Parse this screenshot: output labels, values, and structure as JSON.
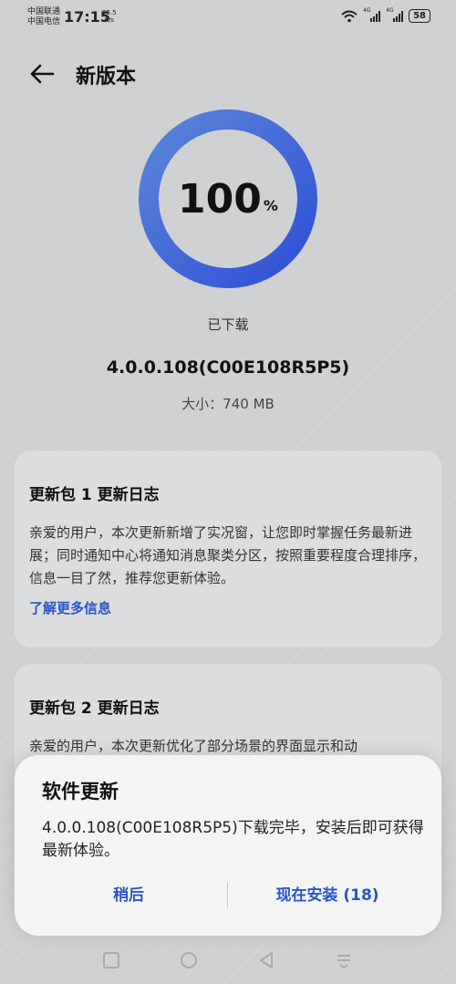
{
  "status_bar": {
    "carrier_1": "中国联通",
    "carrier_2": "中国电信",
    "time": "17:15",
    "net_speed_value": "25.5",
    "net_speed_unit": "K/s",
    "network_1": "4G",
    "network_2": "4G",
    "battery": "58"
  },
  "header": {
    "title": "新版本"
  },
  "progress": {
    "percent": 100,
    "value_text": "100",
    "unit": "%",
    "colors": {
      "arc_dark": "#2f4fd6",
      "arc_light": "#5a86d8"
    }
  },
  "download": {
    "status": "已下载",
    "version": "4.0.0.108(C00E108R5P5)",
    "size": "大小：740 MB"
  },
  "changelog": [
    {
      "title": "更新包 1 更新日志",
      "body": "亲爱的用户，本次更新新增了实况窗，让您即时掌握任务最新进展；同时通知中心将通知消息聚类分区，按照重要程度合理排序，信息一目了然，推荐您更新体验。",
      "link": "了解更多信息"
    },
    {
      "title": "更新包 2 更新日志",
      "body": "亲爱的用户，本次更新优化了部分场景的界面显示和动"
    }
  ],
  "dialog": {
    "title": "软件更新",
    "message": "4.0.0.108(C00E108R5P5)下载完毕，安装后即可获得最新体验。",
    "later_label": "稍后",
    "install_label": "现在安装 (18)"
  },
  "accent_color": "#2a55c8"
}
